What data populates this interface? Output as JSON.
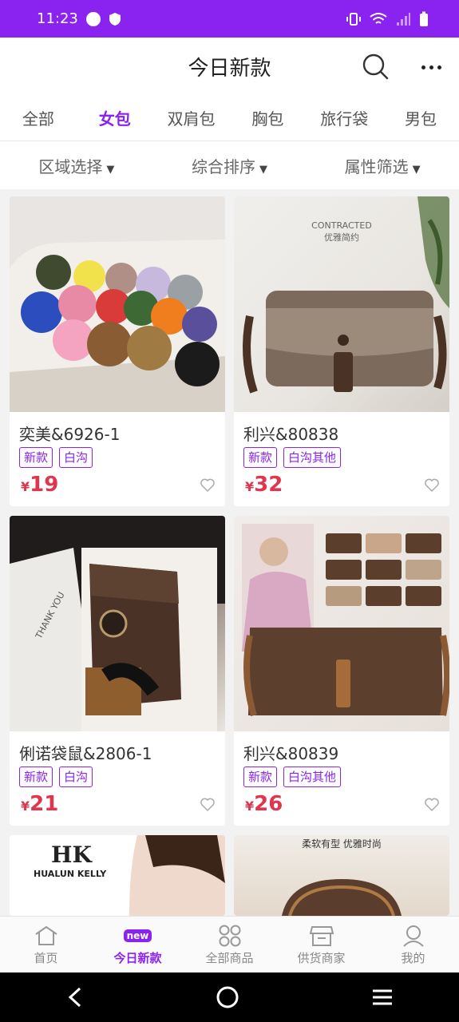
{
  "status_bar": {
    "time": "11:23"
  },
  "header": {
    "title": "今日新款"
  },
  "tabs": [
    {
      "label": "全部",
      "active": false
    },
    {
      "label": "女包",
      "active": true
    },
    {
      "label": "双肩包",
      "active": false
    },
    {
      "label": "胸包",
      "active": false
    },
    {
      "label": "旅行袋",
      "active": false
    },
    {
      "label": "男包",
      "active": false
    }
  ],
  "filters": [
    {
      "label": "区域选择"
    },
    {
      "label": "综合排序"
    },
    {
      "label": "属性筛选"
    }
  ],
  "products": [
    {
      "title": "奕美&6926-1",
      "tags": [
        "新款",
        "白沟"
      ],
      "currency": "¥",
      "price": "19"
    },
    {
      "title": "利兴&80838",
      "tags": [
        "新款",
        "白沟其他"
      ],
      "currency": "¥",
      "price": "32"
    },
    {
      "title": "俐诺袋鼠&2806-1",
      "tags": [
        "新款",
        "白沟"
      ],
      "currency": "¥",
      "price": "21"
    },
    {
      "title": "利兴&80839",
      "tags": [
        "新款",
        "白沟其他"
      ],
      "currency": "¥",
      "price": "26"
    }
  ],
  "image_text": {
    "contracted": "CONTRACTED",
    "contracted_cn": "优雅简约",
    "thank_you": "THANK YOU",
    "hualun_logo": "HK",
    "hualun_brand": "HUALUN KELLY",
    "soft_tagline": "柔软有型 优雅时尚"
  },
  "bottom_nav": [
    {
      "label": "首页",
      "icon": "home-icon",
      "active": false
    },
    {
      "label": "今日新款",
      "icon": "new-icon",
      "badge": "new",
      "active": true
    },
    {
      "label": "全部商品",
      "icon": "grid-icon",
      "active": false
    },
    {
      "label": "供货商家",
      "icon": "store-icon",
      "active": false
    },
    {
      "label": "我的",
      "icon": "user-icon",
      "active": false
    }
  ],
  "colors": {
    "accent": "#8a22f0",
    "price": "#e0354d"
  }
}
